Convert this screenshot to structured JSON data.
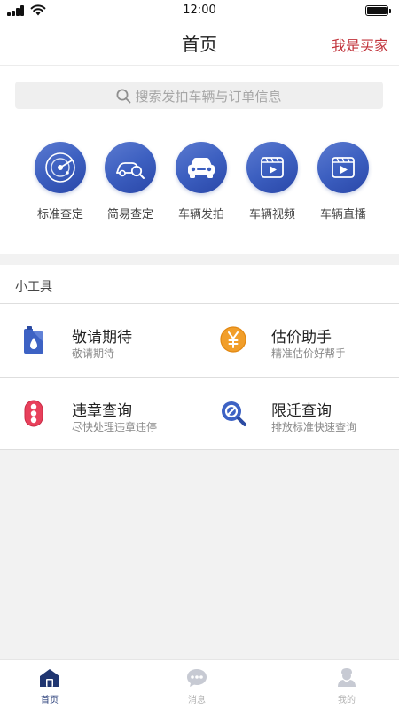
{
  "status_bar": {
    "time": "12:00"
  },
  "nav": {
    "title": "首页",
    "action": "我是买家"
  },
  "search": {
    "placeholder": "搜索发拍车辆与订单信息"
  },
  "quick_actions": [
    {
      "label": "标准查定",
      "icon": "radar-icon"
    },
    {
      "label": "简易查定",
      "icon": "car-search-icon"
    },
    {
      "label": "车辆发拍",
      "icon": "car-front-icon"
    },
    {
      "label": "车辆视频",
      "icon": "video-icon"
    },
    {
      "label": "车辆直播",
      "icon": "live-video-icon"
    }
  ],
  "tools": {
    "title": "小工具",
    "items": [
      {
        "name": "敬请期待",
        "desc": "敬请期待",
        "icon": "fuel-can-icon"
      },
      {
        "name": "估价助手",
        "desc": "精准估价好帮手",
        "icon": "yen-coin-icon"
      },
      {
        "name": "违章查询",
        "desc": "尽快处理违章违停",
        "icon": "traffic-light-icon"
      },
      {
        "name": "限迁查询",
        "desc": "排放标准快速查询",
        "icon": "restriction-search-icon"
      }
    ]
  },
  "tab_bar": {
    "active": "首页",
    "items": [
      {
        "label": "首页",
        "icon": "home-icon"
      },
      {
        "label": "消息",
        "icon": "message-icon"
      },
      {
        "label": "我的",
        "icon": "profile-icon"
      }
    ]
  },
  "colors": {
    "brand_blue": "#3c5fc0",
    "action_red": "#c1323a",
    "tab_active": "#2a3f7a"
  }
}
